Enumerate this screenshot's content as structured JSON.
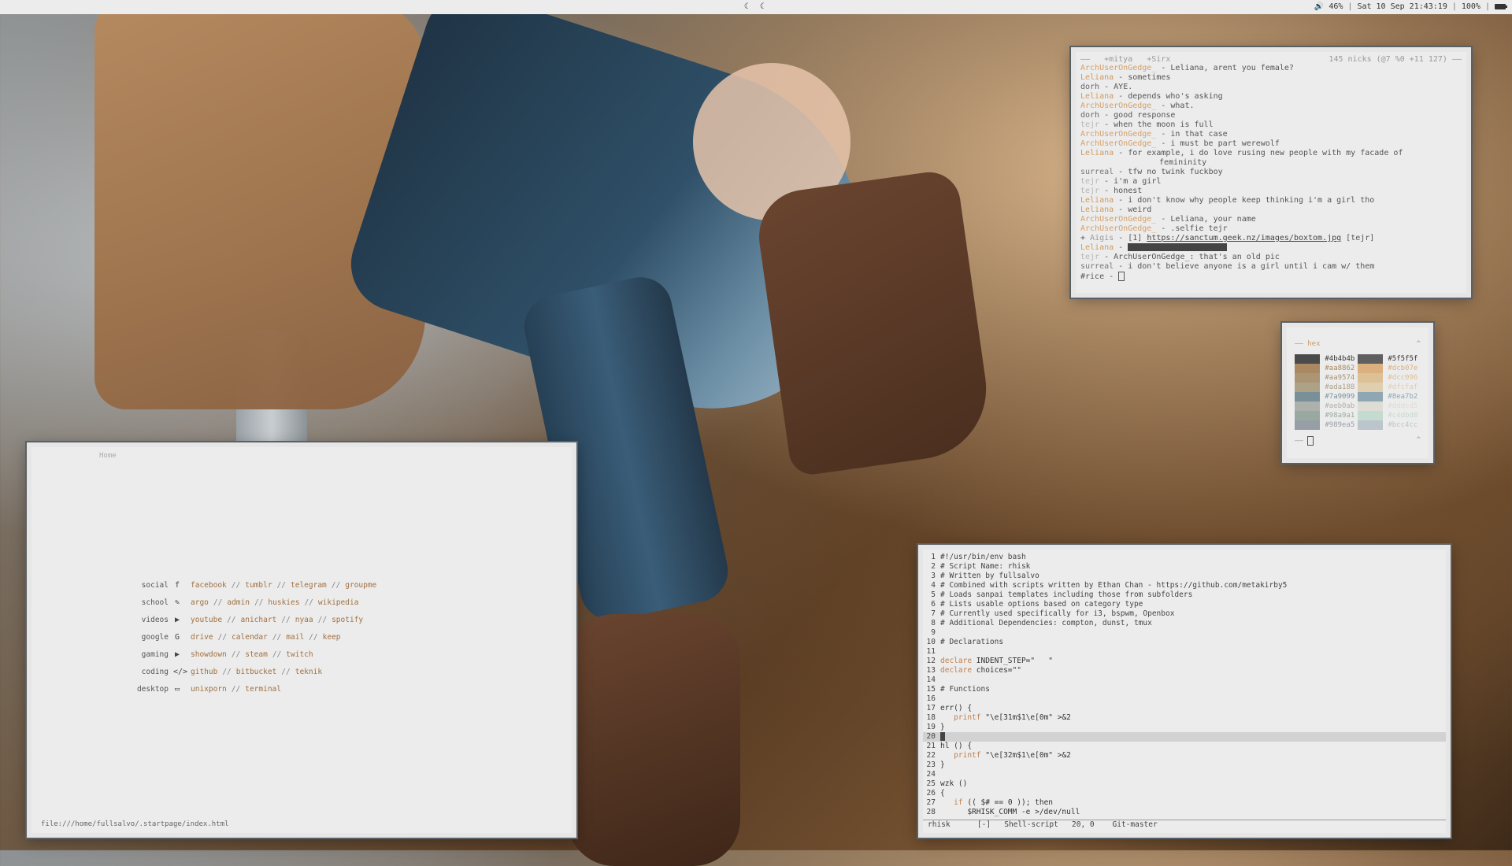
{
  "topbar": {
    "center_icons": "☾ ☾",
    "volume": "46%",
    "datetime": "Sat 10 Sep 21:43:19",
    "battery": "100%"
  },
  "irc": {
    "tabs": [
      "+mitya",
      "+Sirx"
    ],
    "nicks_info": "145 nicks (@7 %0 +11 127)",
    "lines": [
      {
        "nick": "ArchUserOnGedge_",
        "cls": "n-arch",
        "msg": "Leliana, arent you female?"
      },
      {
        "nick": "Leliana",
        "cls": "n-leli",
        "msg": "sometimes"
      },
      {
        "nick": "dorh",
        "cls": "n-dorh",
        "msg": "AYE."
      },
      {
        "nick": "Leliana",
        "cls": "n-leli",
        "msg": "depends who's asking"
      },
      {
        "nick": "ArchUserOnGedge_",
        "cls": "n-arch",
        "msg": "what."
      },
      {
        "nick": "dorh",
        "cls": "n-dorh",
        "msg": "good response"
      },
      {
        "nick": "tejr",
        "cls": "n-tejr",
        "msg": "when the moon is full"
      },
      {
        "nick": "ArchUserOnGedge_",
        "cls": "n-arch",
        "msg": "in that case"
      },
      {
        "nick": "ArchUserOnGedge_",
        "cls": "n-arch",
        "msg": "i must be part werewolf"
      },
      {
        "nick": "Leliana",
        "cls": "n-leli",
        "msg": "for example, i do love rusing new people with my facade of"
      },
      {
        "cont": "femininity"
      },
      {
        "nick": "surreal",
        "cls": "n-surr",
        "msg": "tfw no twink fuckboy"
      },
      {
        "nick": "tejr",
        "cls": "n-tejr",
        "msg": "i'm a girl"
      },
      {
        "nick": "tejr",
        "cls": "n-tejr",
        "msg": "honest"
      },
      {
        "nick": "Leliana",
        "cls": "n-leli",
        "msg": "i don't know why people keep thinking i'm a girl tho"
      },
      {
        "nick": "Leliana",
        "cls": "n-leli",
        "msg": "weird"
      },
      {
        "nick": "ArchUserOnGedge_",
        "cls": "n-arch",
        "msg": "Leliana, your name"
      },
      {
        "nick": "ArchUserOnGedge_",
        "cls": "n-arch",
        "msg": ".selfie tejr"
      }
    ],
    "aigis_line": {
      "prefix": "+",
      "nick": "Aigis",
      "pre": "[1]",
      "url": "https://sanctum.geek.nz/images/boxtom.jpg",
      "post": "[tejr]"
    },
    "leliana_redacted": {
      "nick": "Leliana"
    },
    "tail": [
      {
        "nick": "tejr",
        "cls": "n-tejr",
        "msg": "ArchUserOnGedge_: that's an old pic"
      },
      {
        "nick": "surreal",
        "cls": "n-surr",
        "msg": "i don't believe anyone is a girl until i cam w/ them"
      }
    ],
    "prompt": "#rice -"
  },
  "hex": {
    "title": "hex",
    "dash": "——",
    "caret": "^",
    "foot_left": "——",
    "foot_right": "^",
    "rows": [
      {
        "c1": "#4b4b4b",
        "c2": "#5f5f5f"
      },
      {
        "c1": "#aa8862",
        "c2": "#dcb07e"
      },
      {
        "c1": "#aa9574",
        "c2": "#dcc096"
      },
      {
        "c1": "#ada188",
        "c2": "#dfcfaf"
      },
      {
        "c1": "#7a9099",
        "c2": "#8ea7b2"
      },
      {
        "c1": "#aeb0ab",
        "c2": "#dddcd5"
      },
      {
        "c1": "#98a9a1",
        "c2": "#c4dbd0"
      },
      {
        "c1": "#989ea5",
        "c2": "#bcc4cc"
      }
    ]
  },
  "browser": {
    "home": "Home",
    "status": "file:///home/fullsalvo/.startpage/index.html",
    "rows": [
      {
        "cat": "social",
        "icon": "f",
        "icon_name": "facebook-icon",
        "items": [
          "facebook",
          "tumblr",
          "telegram",
          "groupme"
        ]
      },
      {
        "cat": "school",
        "icon": "✎",
        "icon_name": "pencil-icon",
        "items": [
          "argo",
          "admin",
          "huskies",
          "wikipedia"
        ]
      },
      {
        "cat": "videos",
        "icon": "▶",
        "icon_name": "youtube-icon",
        "items": [
          "youtube",
          "anichart",
          "nyaa",
          "spotify"
        ]
      },
      {
        "cat": "google",
        "icon": "G",
        "icon_name": "google-icon",
        "items": [
          "drive",
          "calendar",
          "mail",
          "keep"
        ]
      },
      {
        "cat": "gaming",
        "icon": "▶",
        "icon_name": "play-icon",
        "items": [
          "showdown",
          "steam",
          "twitch"
        ]
      },
      {
        "cat": "coding",
        "icon": "</>",
        "icon_name": "code-icon",
        "items": [
          "github",
          "bitbucket",
          "teknik"
        ]
      },
      {
        "cat": "desktop",
        "icon": "▭",
        "icon_name": "laptop-icon",
        "items": [
          "unixporn",
          "terminal"
        ]
      }
    ]
  },
  "vim": {
    "lines": [
      {
        "n": "1",
        "t": "#!/usr/bin/env bash"
      },
      {
        "n": "2",
        "t": "# Script Name: rhisk"
      },
      {
        "n": "3",
        "t": "# Written by fullsalvo"
      },
      {
        "n": "4",
        "t": "# Combined with scripts written by Ethan Chan - https://github.com/metakirby5"
      },
      {
        "n": "5",
        "t": "# Loads sanpai templates including those from subfolders"
      },
      {
        "n": "6",
        "t": "# Lists usable options based on category type"
      },
      {
        "n": "7",
        "t": "# Currently used specifically for i3, bspwm, Openbox"
      },
      {
        "n": "8",
        "t": "# Additional Dependencies: compton, dunst, tmux"
      },
      {
        "n": "9",
        "t": ""
      },
      {
        "n": "10",
        "t": "# Declarations"
      },
      {
        "n": "11",
        "t": ""
      },
      {
        "n": "12",
        "t": "declare INDENT_STEP=\"   \""
      },
      {
        "n": "13",
        "t": "declare choices=\"\""
      },
      {
        "n": "14",
        "t": ""
      },
      {
        "n": "15",
        "t": "# Functions"
      },
      {
        "n": "16",
        "t": ""
      },
      {
        "n": "17",
        "t": "err() {"
      },
      {
        "n": "18",
        "t": "   printf \"\\e[31m$1\\e[0m\" >&2"
      },
      {
        "n": "19",
        "t": "}"
      },
      {
        "n": "20",
        "t": ""
      },
      {
        "n": "21",
        "t": "hl () {"
      },
      {
        "n": "22",
        "t": "   printf \"\\e[32m$1\\e[0m\" >&2"
      },
      {
        "n": "23",
        "t": "}"
      },
      {
        "n": "24",
        "t": ""
      },
      {
        "n": "25",
        "t": "wzk ()"
      },
      {
        "n": "26",
        "t": "{"
      },
      {
        "n": "27",
        "t": "   if (( $# == 0 )); then"
      },
      {
        "n": "28",
        "t": "      $RHISK_COMM -e >/dev/null"
      }
    ],
    "cursor_line": "20",
    "status": "rhisk      [-]   Shell-script   20, 0    Git-master"
  }
}
